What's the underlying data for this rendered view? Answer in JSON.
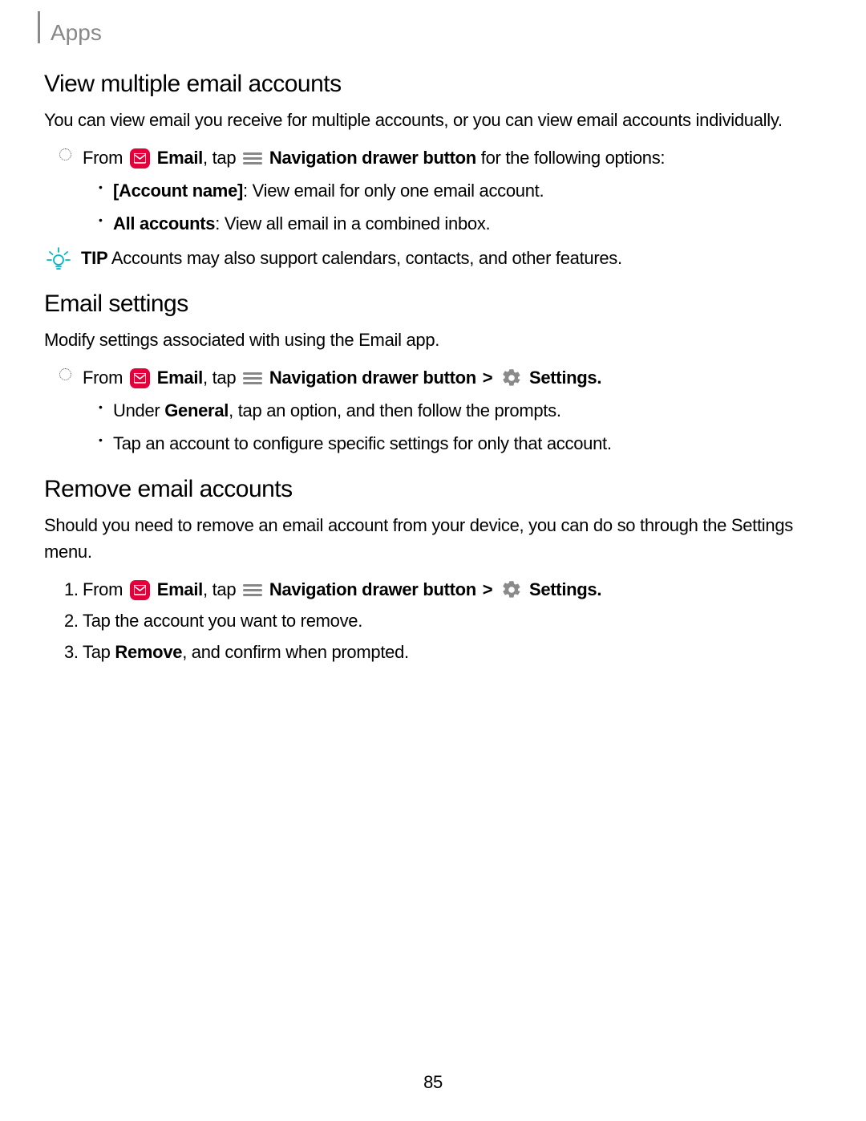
{
  "header": {
    "title": "Apps"
  },
  "section1": {
    "heading": "View multiple email accounts",
    "intro": "You can view email you receive for multiple accounts, or you can view email accounts individually.",
    "step": {
      "from": "From ",
      "email_label": "Email",
      "tap": ", tap ",
      "nav_label": "Navigation drawer button",
      "tail": " for the following options:"
    },
    "bullets": {
      "b1_bold": "[Account name]",
      "b1_rest": ": View email for only one email account.",
      "b2_bold": "All accounts",
      "b2_rest": ": View all email in a combined inbox."
    }
  },
  "tip": {
    "label": "TIP",
    "text": " Accounts may also support calendars, contacts, and other features."
  },
  "section2": {
    "heading": "Email settings",
    "intro": "Modify settings associated with using the Email app.",
    "step": {
      "from": "From ",
      "email_label": "Email",
      "tap": ", tap ",
      "nav_label": "Navigation drawer button",
      "gt": " > ",
      "settings_label": "Settings",
      "period": "."
    },
    "bullets": {
      "b1_a": "Under ",
      "b1_bold": "General",
      "b1_b": ", tap an option, and then follow the prompts.",
      "b2": "Tap an account to configure specific settings for only that account."
    }
  },
  "section3": {
    "heading": "Remove email accounts",
    "intro": "Should you need to remove an email account from your device, you can do so through the Settings menu.",
    "steps": {
      "s1": {
        "from": "From ",
        "email_label": "Email",
        "tap": ", tap ",
        "nav_label": "Navigation drawer button",
        "gt": " > ",
        "settings_label": "Settings",
        "period": "."
      },
      "s2": "Tap the account you want to remove.",
      "s3_a": "Tap ",
      "s3_bold": "Remove",
      "s3_b": ", and confirm when prompted."
    }
  },
  "page_number": "85"
}
